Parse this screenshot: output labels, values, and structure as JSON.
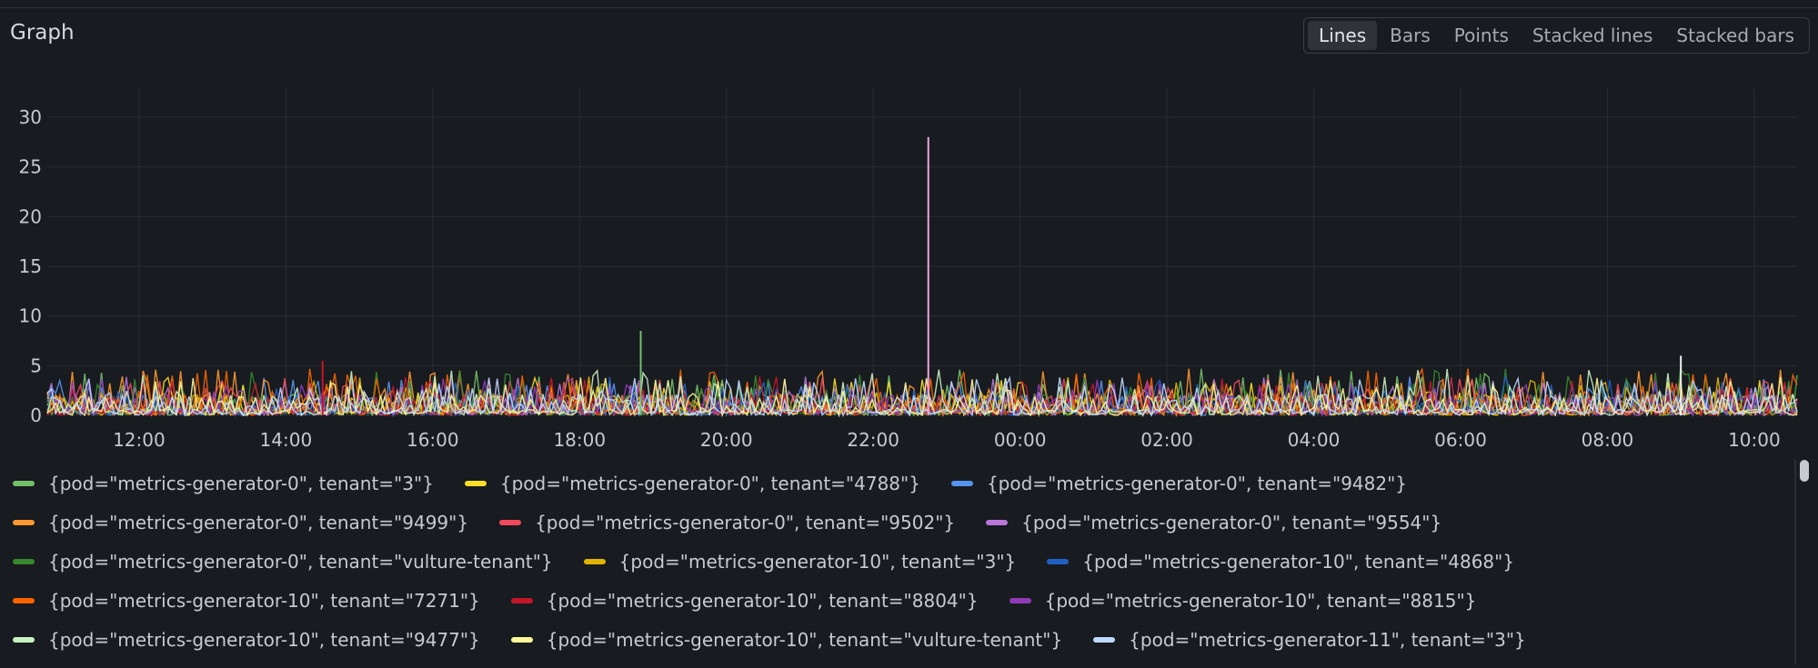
{
  "panel": {
    "title": "Graph",
    "viz_options": [
      "Lines",
      "Bars",
      "Points",
      "Stacked lines",
      "Stacked bars"
    ],
    "active_viz": "Lines"
  },
  "chart_data": {
    "type": "line",
    "y_ticks": [
      "30",
      "25",
      "20",
      "15",
      "10",
      "5",
      "0"
    ],
    "x_ticks": [
      "12:00",
      "14:00",
      "16:00",
      "18:00",
      "20:00",
      "22:00",
      "00:00",
      "02:00",
      "04:00",
      "06:00",
      "08:00",
      "10:00"
    ],
    "ylim": [
      0,
      32
    ],
    "grid": true,
    "legend_placement": "bottom",
    "series": [
      {
        "name": "{pod=\"metrics-generator-0\", tenant=\"3\"}",
        "color": "#73bf69"
      },
      {
        "name": "{pod=\"metrics-generator-0\", tenant=\"4788\"}",
        "color": "#fade2a"
      },
      {
        "name": "{pod=\"metrics-generator-0\", tenant=\"9482\"}",
        "color": "#5794f2"
      },
      {
        "name": "{pod=\"metrics-generator-0\", tenant=\"9499\"}",
        "color": "#ff9830"
      },
      {
        "name": "{pod=\"metrics-generator-0\", tenant=\"9502\"}",
        "color": "#f2495c"
      },
      {
        "name": "{pod=\"metrics-generator-0\", tenant=\"9554\"}",
        "color": "#b877d9"
      },
      {
        "name": "{pod=\"metrics-generator-0\", tenant=\"vulture-tenant\"}",
        "color": "#37872d"
      },
      {
        "name": "{pod=\"metrics-generator-10\", tenant=\"3\"}",
        "color": "#e0b400"
      },
      {
        "name": "{pod=\"metrics-generator-10\", tenant=\"4868\"}",
        "color": "#1f60c4"
      },
      {
        "name": "{pod=\"metrics-generator-10\", tenant=\"7271\"}",
        "color": "#fa6400"
      },
      {
        "name": "{pod=\"metrics-generator-10\", tenant=\"8804\"}",
        "color": "#c4162a"
      },
      {
        "name": "{pod=\"metrics-generator-10\", tenant=\"8815\"}",
        "color": "#8f3bb8"
      },
      {
        "name": "{pod=\"metrics-generator-10\", tenant=\"9477\"}",
        "color": "#c8f2c2"
      },
      {
        "name": "{pod=\"metrics-generator-10\", tenant=\"vulture-tenant\"}",
        "color": "#fff899"
      },
      {
        "name": "{pod=\"metrics-generator-11\", tenant=\"3\"}",
        "color": "#c0d8ff"
      }
    ],
    "spikes": [
      {
        "t": "22:45",
        "value": 28,
        "series_color": "#e8a6e0"
      },
      {
        "t": "18:50",
        "value": 8.5,
        "series_color": "#73bf69"
      },
      {
        "t": "14:30",
        "value": 5.5,
        "series_color": "#c4162a"
      },
      {
        "t": "09:00",
        "value": 6,
        "series_color": "#f0f0f0"
      }
    ]
  }
}
